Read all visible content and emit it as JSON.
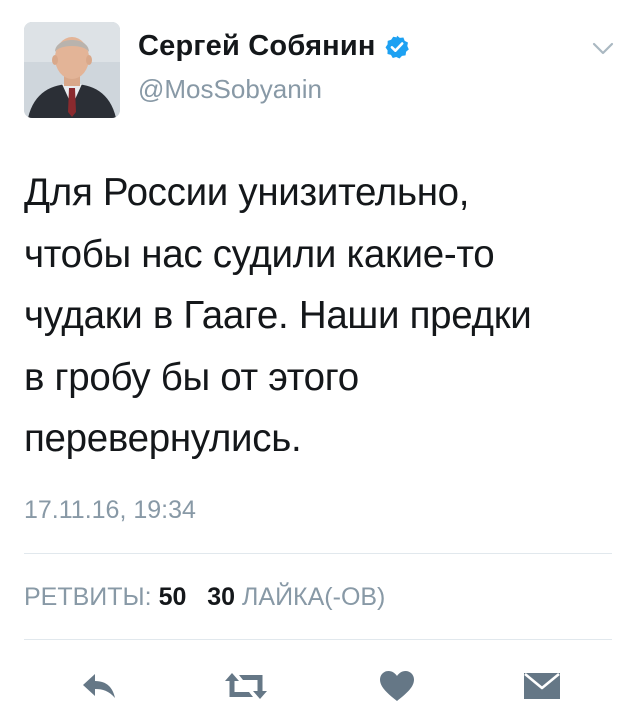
{
  "author": {
    "name": "Сергей Собянин",
    "handle": "@MosSobyanin",
    "avatar_icon": "profile-photo",
    "verified_icon": "verified-badge-icon",
    "verified_color": "#1da1f2"
  },
  "tweet": {
    "lines": [
      "Для России унизительно,",
      "чтобы нас судили какие-то",
      "чудаки в Гааге. Наши предки",
      "в гробу бы от этого",
      "перевернулись."
    ],
    "timestamp": "17.11.16, 19:34"
  },
  "stats": {
    "retweets_label": "РЕТВИТЫ:",
    "retweets_count": "50",
    "likes_count": "30",
    "likes_label": "ЛАЙКА(-ОВ)"
  },
  "actions": {
    "reply_icon": "reply-icon",
    "retweet_icon": "retweet-icon",
    "like_icon": "heart-icon",
    "message_icon": "envelope-icon"
  },
  "colors": {
    "text": "#14171a",
    "secondary": "#8899a6",
    "icon": "#657786",
    "divider": "#e1e8ed"
  }
}
